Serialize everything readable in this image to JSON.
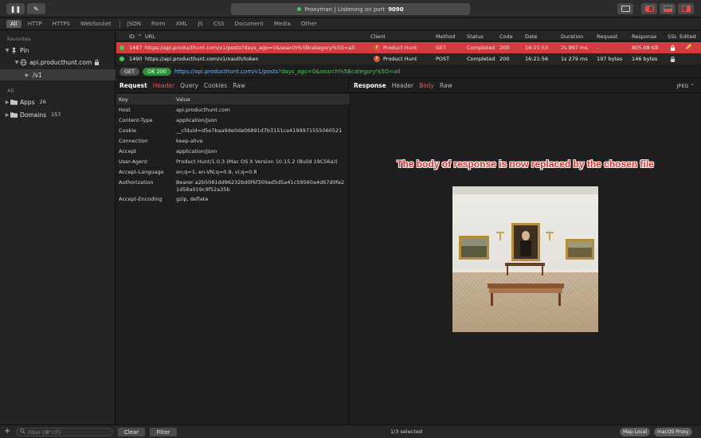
{
  "status_bar": {
    "app_name": "Proxyman | Listening on port ",
    "port": "9090"
  },
  "filters": [
    "All",
    "HTTP",
    "HTTPS",
    "WebSocket",
    "JSON",
    "Form",
    "XML",
    "JS",
    "CSS",
    "Document",
    "Media",
    "Other"
  ],
  "sidebar": {
    "favorites_label": "Favorites",
    "pin_label": "Pin",
    "domain_label": "api.producthunt.com",
    "path_label": "/v1",
    "all_label": "All",
    "apps_label": "Apps",
    "apps_count": "26",
    "domains_label": "Domains",
    "domains_count": "157"
  },
  "table": {
    "headers": {
      "id": "ID",
      "url": "URL",
      "client": "Client",
      "method": "Method",
      "status": "Status",
      "code": "Code",
      "date": "Date",
      "duration": "Duration",
      "request": "Request",
      "response": "Response",
      "ssl": "SSL",
      "edited": "Edited"
    },
    "rows": [
      {
        "id": "1487",
        "url": "https://api.producthunt.com/v1/posts?days_ago=0&search%5Bcategory%5D=all",
        "client": "Product Hunt",
        "method": "GET",
        "status": "Completed",
        "code": "200",
        "date": "16:21:53",
        "duration": "2s 997 ms",
        "request": "-",
        "response": "805.08 KB"
      },
      {
        "id": "1490",
        "url": "https://api.producthunt.com/v1/oauth/token",
        "client": "Product Hunt",
        "method": "POST",
        "status": "Completed",
        "code": "200",
        "date": "16:21:56",
        "duration": "1s 279 ms",
        "request": "197 bytes",
        "response": "146 bytes"
      }
    ]
  },
  "url_bar": {
    "method": "GET",
    "status": "OK 200",
    "url_base": "https://api.producthunt.com/v1/posts",
    "url_query": "?days_ago=0&search%5Bcategory%5D=all"
  },
  "request_pane": {
    "title": "Request",
    "tabs": [
      "Header",
      "Query",
      "Cookies",
      "Raw"
    ],
    "key_header": "Key",
    "value_header": "Value",
    "headers": [
      {
        "key": "Host",
        "value": "api.producthunt.com"
      },
      {
        "key": "Content-Type",
        "value": "application/json"
      },
      {
        "key": "Cookie",
        "value": "__cfduid=d5e7baa9de0da06891d7b3151ca4199971555060521"
      },
      {
        "key": "Connection",
        "value": "keep-alive"
      },
      {
        "key": "Accept",
        "value": "application/json"
      },
      {
        "key": "User-Agent",
        "value": "Product Hunt/1.0.3 (Mac OS X Version 10.15.2 (Build 19C56a))"
      },
      {
        "key": "Accept-Language",
        "value": "en;q=1, en-VN;q=0.9, vi;q=0.8"
      },
      {
        "key": "Authorization",
        "value": "Bearer a2b5081dd96232bd0f6f309ad5d5a41c59560a4d67d0fe21d58a019c9f52a35b"
      },
      {
        "key": "Accept-Encoding",
        "value": "gzip, deflate"
      }
    ]
  },
  "response_pane": {
    "title": "Response",
    "tabs": [
      "Header",
      "Body",
      "Raw"
    ],
    "format": "JPEG",
    "annotation": "The body of response is now replaced by the chosen file"
  },
  "bottom": {
    "filter_placeholder": "Filter (⌘⌥F)",
    "clear_label": "Clear",
    "filter_label": "Filter",
    "selection": "1/3 selected",
    "map_local": "Map Local",
    "macos_proxy": "macOS Proxy"
  }
}
